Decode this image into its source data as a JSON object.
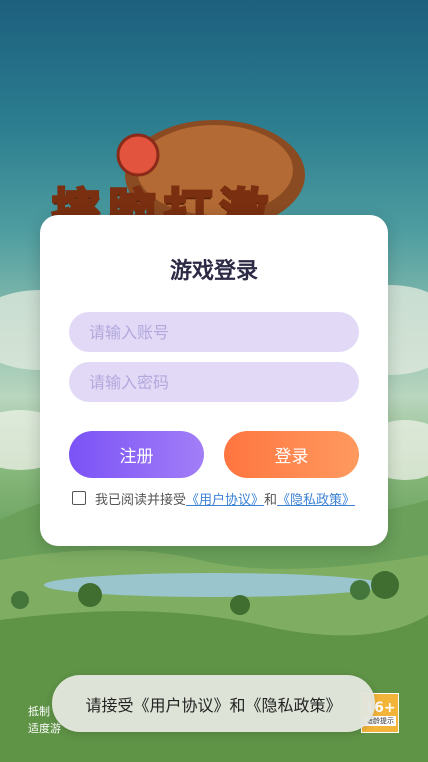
{
  "background": {
    "logo_text": "摔脑打激",
    "bottom_note_lines": [
      "抵制",
      "适度游"
    ],
    "age_badge": {
      "label": "16+",
      "caption": "适龄提示"
    }
  },
  "dialog": {
    "title": "游戏登录",
    "account_placeholder": "请输入账号",
    "password_placeholder": "请输入密码",
    "register_label": "注册",
    "login_label": "登录",
    "agreement": {
      "prefix": "我已阅读并接受",
      "user_agreement": "《用户协议》",
      "and": "和",
      "privacy_policy": "《隐私政策》",
      "checked": false
    }
  },
  "toast": {
    "message": "请接受《用户协议》和《隐私政策》"
  },
  "colors": {
    "register_button": "#7b52f6",
    "login_button": "#ff7540",
    "input_bg": "#e1d9f6",
    "link": "#3b82d6"
  }
}
